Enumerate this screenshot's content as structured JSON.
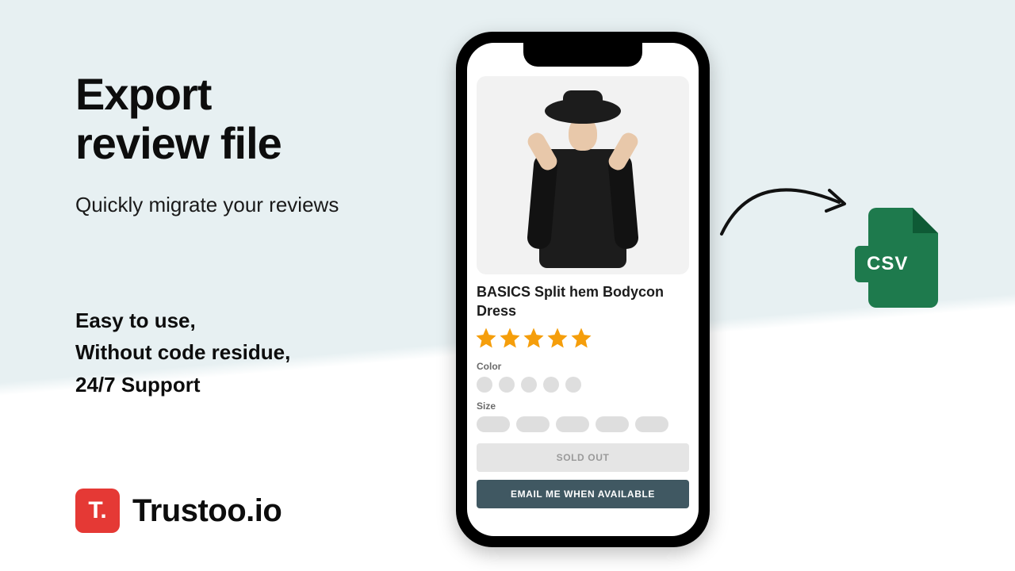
{
  "hero": {
    "title_line1": "Export",
    "title_line2": "review file",
    "subtitle": "Quickly migrate your reviews",
    "feature_line1": "Easy to use,",
    "feature_line2": "Without code residue,",
    "feature_line3": "24/7 Support"
  },
  "brand": {
    "badge_letter": "T.",
    "name": "Trustoo.io"
  },
  "product": {
    "title": "BASICS Split hem Bodycon Dress",
    "rating": 5,
    "color_label": "Color",
    "color_count": 5,
    "size_label": "Size",
    "size_count": 5,
    "sold_out_label": "SOLD OUT",
    "email_button_label": "EMAIL ME WHEN AVAILABLE"
  },
  "csv": {
    "label": "CSV",
    "color": "#1e7a4d"
  }
}
